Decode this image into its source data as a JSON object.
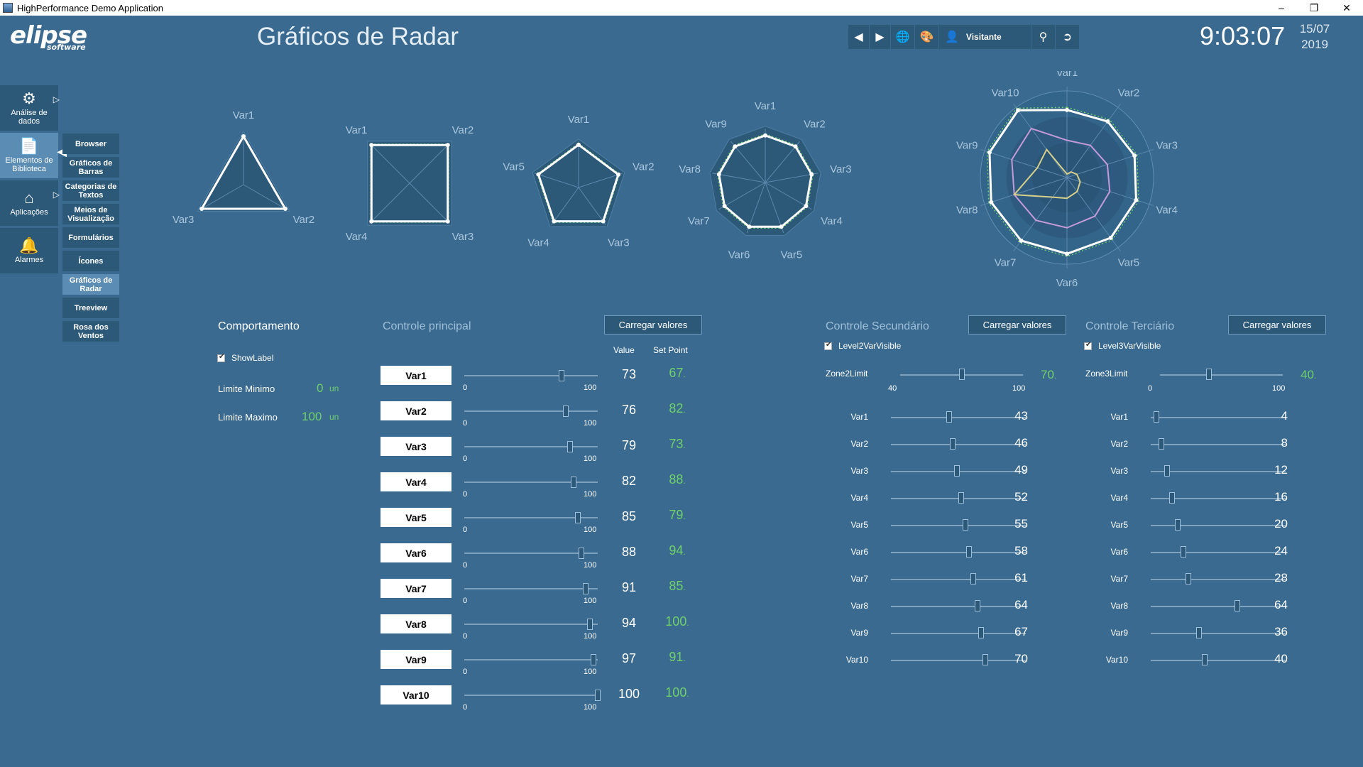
{
  "window": {
    "title": "HighPerformance Demo Application",
    "minimize": "–",
    "maximize": "❐",
    "close": "✕"
  },
  "logo": {
    "brand": "elipse",
    "sub": "software"
  },
  "page_title": "Gráficos de Radar",
  "header": {
    "user": "Visitante",
    "time": "9:03:07",
    "date_day": "15/07",
    "date_year": "2019"
  },
  "sidebar": [
    {
      "label": "Análise de dados",
      "icon": "gear-icon"
    },
    {
      "label": "Elementos de Biblioteca",
      "icon": "document-icon"
    },
    {
      "label": "Aplicações",
      "icon": "home-icon"
    },
    {
      "label": "Alarmes",
      "icon": "bell-icon"
    }
  ],
  "subnav": [
    "Browser",
    "Gráficos de Barras",
    "Categorias de Textos",
    "Meios de Visualização",
    "Formulários",
    "Ícones",
    "Gráficos de Radar",
    "Treeview",
    "Rosa dos Ventos"
  ],
  "radars": [
    {
      "vars": [
        "Var1",
        "Var2",
        "Var3"
      ]
    },
    {
      "vars": [
        "Var1",
        "Var2",
        "Var3",
        "Var4"
      ]
    },
    {
      "vars": [
        "Var1",
        "Var2",
        "Var3",
        "Var4",
        "Var5"
      ]
    },
    {
      "vars": [
        "Var1",
        "Var2",
        "Var3",
        "Var4",
        "Var5",
        "Var6",
        "Var7",
        "Var8",
        "Var9"
      ]
    },
    {
      "vars": [
        "Var1",
        "Var2",
        "Var3",
        "Var4",
        "Var5",
        "Var6",
        "Var7",
        "Var8",
        "Var9",
        "Var10"
      ]
    }
  ],
  "comportamento": {
    "title": "Comportamento",
    "show_label": "ShowLabel",
    "limite_minimo_label": "Limite Minimo",
    "limite_minimo": "0",
    "limite_maximo_label": "Limite Maximo",
    "limite_maximo": "100",
    "unit": "un"
  },
  "principal": {
    "title": "Controle principal",
    "button": "Carregar valores",
    "col_value": "Value",
    "col_setpoint": "Set Point",
    "min": "0",
    "max": "100",
    "rows": [
      {
        "name": "Var1",
        "value": 73,
        "setpoint": "67"
      },
      {
        "name": "Var2",
        "value": 76,
        "setpoint": "82"
      },
      {
        "name": "Var3",
        "value": 79,
        "setpoint": "73"
      },
      {
        "name": "Var4",
        "value": 82,
        "setpoint": "88"
      },
      {
        "name": "Var5",
        "value": 85,
        "setpoint": "79"
      },
      {
        "name": "Var6",
        "value": 88,
        "setpoint": "94"
      },
      {
        "name": "Var7",
        "value": 91,
        "setpoint": "85"
      },
      {
        "name": "Var8",
        "value": 94,
        "setpoint": "100"
      },
      {
        "name": "Var9",
        "value": 97,
        "setpoint": "91"
      },
      {
        "name": "Var10",
        "value": 100,
        "setpoint": "100"
      }
    ]
  },
  "secundario": {
    "title": "Controle Secundário",
    "button": "Carregar valores",
    "checkbox": "Level2VarVisible",
    "zone_label": "Zone2Limit",
    "zone_value": "70",
    "zone_min": "40",
    "zone_max": "100",
    "rows": [
      {
        "name": "Var1",
        "value": 43
      },
      {
        "name": "Var2",
        "value": 46
      },
      {
        "name": "Var3",
        "value": 49
      },
      {
        "name": "Var4",
        "value": 52
      },
      {
        "name": "Var5",
        "value": 55
      },
      {
        "name": "Var6",
        "value": 58
      },
      {
        "name": "Var7",
        "value": 61
      },
      {
        "name": "Var8",
        "value": 64
      },
      {
        "name": "Var9",
        "value": 67
      },
      {
        "name": "Var10",
        "value": 70
      }
    ]
  },
  "terciario": {
    "title": "Controle Terciário",
    "button": "Carregar valores",
    "checkbox": "Level3VarVisible",
    "zone_label": "Zone3Limit",
    "zone_value": "40",
    "zone_min": "0",
    "zone_max": "100",
    "rows": [
      {
        "name": "Var1",
        "value": 4
      },
      {
        "name": "Var2",
        "value": 8
      },
      {
        "name": "Var3",
        "value": 12
      },
      {
        "name": "Var4",
        "value": 16
      },
      {
        "name": "Var5",
        "value": 20
      },
      {
        "name": "Var6",
        "value": 24
      },
      {
        "name": "Var7",
        "value": 28
      },
      {
        "name": "Var8",
        "value": 64
      },
      {
        "name": "Var9",
        "value": 36
      },
      {
        "name": "Var10",
        "value": 40
      }
    ]
  },
  "colors": {
    "bg": "#3a6a8f",
    "panel": "#2d5979",
    "accent": "#6fd16a",
    "level2": "#c59ad8",
    "level3": "#d8d08a"
  }
}
